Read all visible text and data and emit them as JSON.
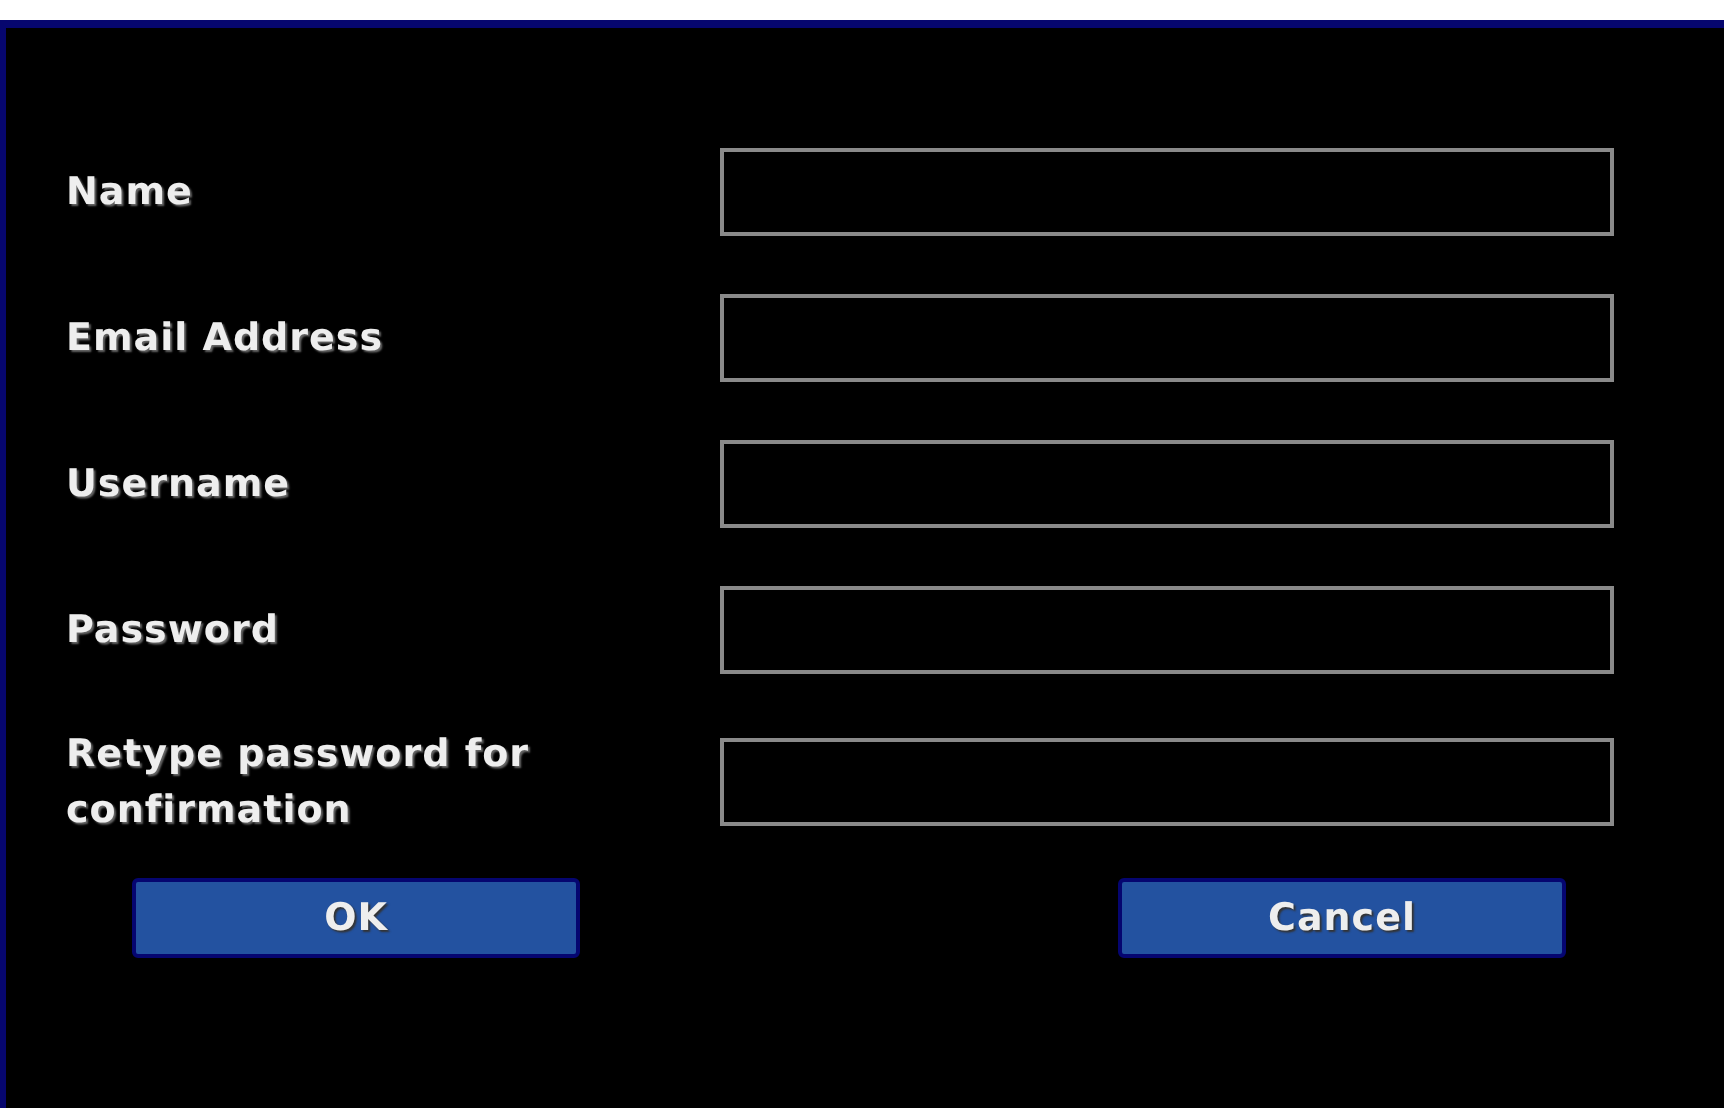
{
  "fields": [
    {
      "label": "Name"
    },
    {
      "label": "Email Address"
    },
    {
      "label": "Username"
    },
    {
      "label": "Password"
    },
    {
      "label": "Retype password for confirmation"
    }
  ],
  "buttons": [
    "OK",
    "Cancel"
  ]
}
